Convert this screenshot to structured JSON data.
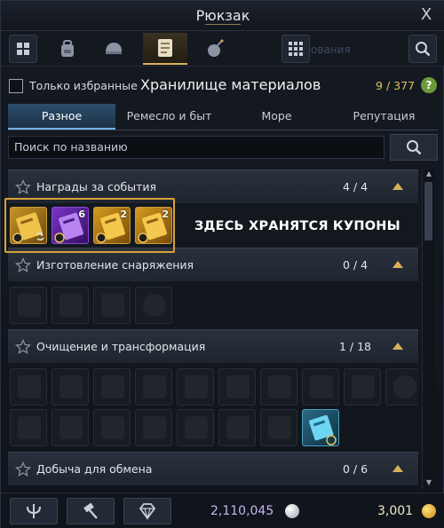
{
  "window": {
    "title": "Рюкзак",
    "close_glyph": "X"
  },
  "topbar": {
    "left_button": "grid-icon",
    "tabs": [
      {
        "icon": "backpack-icon",
        "active": false
      },
      {
        "icon": "helmet-icon",
        "active": false
      },
      {
        "icon": "book-icon",
        "active": true
      },
      {
        "icon": "bomb-icon",
        "active": false
      }
    ],
    "right_buttons": [
      "grid-view-icon",
      "search-icon"
    ]
  },
  "filter": {
    "favorites_label": "Только избранные",
    "panel_title": "Хранилище материалов",
    "count": "9 / 377",
    "help": "?"
  },
  "tabs": [
    "Разное",
    "Ремесло и быт",
    "Море",
    "Репутация"
  ],
  "search": {
    "placeholder": "Поиск по названию"
  },
  "categories": [
    {
      "name": "Награды за события",
      "count": "4 / 4",
      "items": [
        {
          "icon": "gold-coupon-icon",
          "qty": ""
        },
        {
          "icon": "purple-coupon-icon",
          "qty": "6"
        },
        {
          "icon": "gold-coupon-icon",
          "qty": "2"
        },
        {
          "icon": "gold-coupon-icon",
          "qty": "2"
        }
      ]
    },
    {
      "name": "Изготовление снаряжения",
      "count": "0 / 4",
      "items_count": 4
    },
    {
      "name": "Очищение и трансформация",
      "count": "1 / 18",
      "items_count": 18
    },
    {
      "name": "Добыча для обмена",
      "count": "0 / 6"
    }
  ],
  "annotation": "ЗДЕСЬ ХРАНЯТСЯ КУПОНЫ",
  "currency": {
    "silver": "2,110,045",
    "gold": "3,001"
  },
  "colors": {
    "accent_gold": "#d6a23a",
    "tab_active": "#2c4e6c",
    "count_gold": "#e0c060"
  }
}
